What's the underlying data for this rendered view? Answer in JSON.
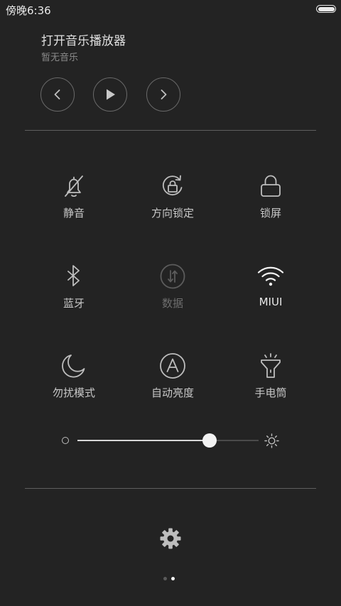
{
  "status_bar": {
    "time": "傍晚6:36"
  },
  "music": {
    "title": "打开音乐播放器",
    "subtitle": "暂无音乐",
    "controls": [
      "prev-icon",
      "play-icon",
      "next-icon"
    ]
  },
  "toggles": [
    {
      "label": "静音",
      "icon": "bell-off-icon",
      "state": "off"
    },
    {
      "label": "方向锁定",
      "icon": "rotation-lock-icon",
      "state": "off"
    },
    {
      "label": "锁屏",
      "icon": "lock-icon",
      "state": "off"
    },
    {
      "label": "蓝牙",
      "icon": "bluetooth-icon",
      "state": "off"
    },
    {
      "label": "数据",
      "icon": "mobile-data-icon",
      "state": "disabled"
    },
    {
      "label": "MIUI",
      "icon": "wifi-icon",
      "state": "on"
    },
    {
      "label": "勿扰模式",
      "icon": "moon-icon",
      "state": "off"
    },
    {
      "label": "自动亮度",
      "icon": "auto-brightness-icon",
      "state": "off"
    },
    {
      "label": "手电筒",
      "icon": "flashlight-icon",
      "state": "off"
    }
  ],
  "brightness": {
    "level_percent": 73
  },
  "pager": {
    "total": 2,
    "current": 2
  },
  "colors": {
    "background": "#232323",
    "icon_normal": "#bdbdbd",
    "icon_disabled": "#5c5c5c",
    "icon_active": "#f2f2f2"
  }
}
